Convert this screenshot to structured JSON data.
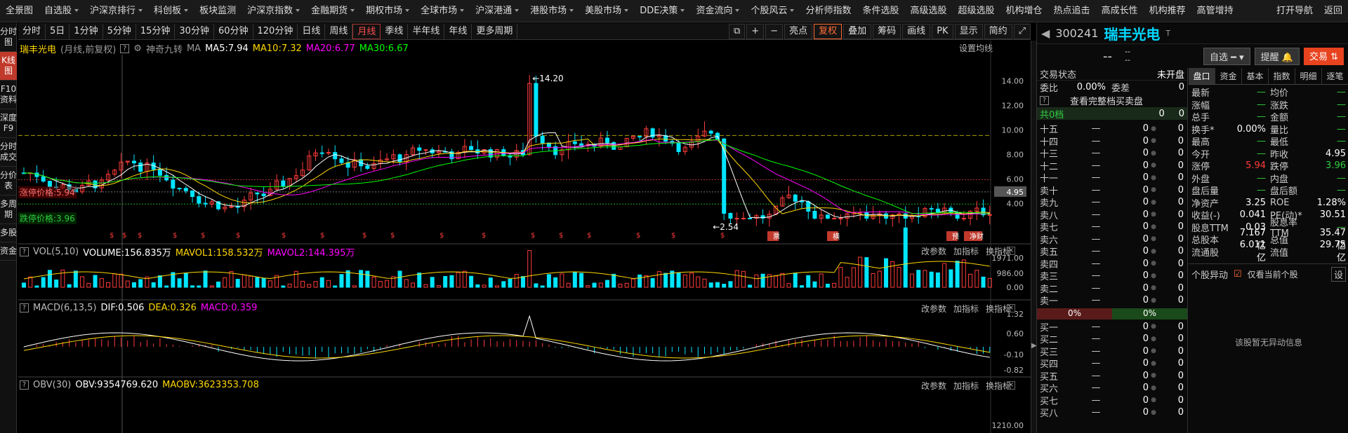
{
  "topnav": {
    "items": [
      "全景图",
      "自选股",
      "沪深京排行",
      "科创板",
      "板块监测",
      "沪深京指数",
      "金融期货",
      "期权市场",
      "全球市场",
      "沪深港通",
      "港股市场",
      "美股市场",
      "DDE决策",
      "资金流向",
      "个股风云",
      "分析师指数",
      "条件选股",
      "高级选股",
      "超级选股",
      "机构增仓",
      "热点追击",
      "高成长性",
      "机构推荐",
      "高管增持"
    ],
    "right": [
      "打开导航",
      "返回"
    ]
  },
  "leftbar": [
    "分时图",
    "K线图",
    "F10资料",
    "深度F9",
    "分时成交",
    "分价表",
    "多周期",
    "多股",
    "资金"
  ],
  "period": {
    "items": [
      "分时",
      "5日",
      "1分钟",
      "5分钟",
      "15分钟",
      "30分钟",
      "60分钟",
      "120分钟",
      "日线",
      "周线",
      "月线",
      "季线",
      "半年线",
      "年线",
      "更多周期"
    ],
    "active": "月线"
  },
  "tools": {
    "bright": "亮点",
    "restore": "复权",
    "overlay": "叠加",
    "chips": "筹码",
    "draw": "画线",
    "pk": "PK",
    "display": "显示",
    "simple": "简约"
  },
  "kpane": {
    "name": "瑞丰光电",
    "mode": "(月线,前复权)",
    "indicator": "神奇九转",
    "ma_label": "MA",
    "ma5": "MA5:7.94",
    "ma10": "MA10:7.32",
    "ma20": "MA20:6.77",
    "ma30": "MA30:6.67",
    "settings": "设置均线",
    "high_label": "14.20",
    "low_label": "2.54",
    "limit_up": "涨停价格:5.94",
    "limit_down": "跌停价格:3.96",
    "cur_price": "4.95",
    "yaxis": [
      "14.00",
      "12.00",
      "10.00",
      "8.00",
      "6.00",
      "4.00"
    ],
    "markers": [
      "票",
      "横",
      "预",
      "净财"
    ]
  },
  "vol": {
    "label": "VOL(5,10)",
    "volume": "VOLUME:156.835万",
    "mavol1": "MAVOL1:158.532万",
    "mavol2": "MAVOL2:144.395万",
    "yaxis": [
      "1971.00",
      "986.00",
      "0.00"
    ]
  },
  "macd": {
    "label": "MACD(6,13,5)",
    "dif": "DIF:0.506",
    "dea": "DEA:0.326",
    "macd": "MACD:0.359",
    "yaxis": [
      "1.32",
      "0.60",
      "-0.10",
      "-0.82"
    ]
  },
  "obv": {
    "label": "OBV(30)",
    "obv": "OBV:9354769.620",
    "maobv": "MAOBV:3623353.708",
    "yaxis": [
      "1210.00"
    ]
  },
  "pane_actions": [
    "改参数",
    "加指标",
    "换指标"
  ],
  "stock": {
    "code": "300241",
    "name": "瑞丰光电",
    "suffix": "T",
    "price": "--",
    "change": "--",
    "pct": "--",
    "self": "自选",
    "alert": "提醒",
    "trade": "交易"
  },
  "orderbook": {
    "status_label": "交易状态",
    "status": "未开盘",
    "weibi": "委比",
    "weibi_val": "0.00%",
    "weicha": "委差",
    "weicha_val": "0",
    "full_depth": "查看完整档买卖盘",
    "total": "共0档",
    "sell_labels": [
      "十五",
      "十四",
      "十三",
      "十二",
      "十一",
      "卖十",
      "卖九",
      "卖八",
      "卖七",
      "卖六",
      "卖五",
      "卖四",
      "卖三",
      "卖二",
      "卖一"
    ],
    "buy_labels": [
      "买一",
      "买二",
      "买三",
      "买四",
      "买五",
      "买六",
      "买七",
      "买八"
    ],
    "sell_pct": "0%",
    "buy_pct": "0%"
  },
  "quote": {
    "tabs": [
      "盘口",
      "资金",
      "基本",
      "指数",
      "明细",
      "逐笔"
    ],
    "rows": [
      [
        "最新",
        "—",
        "均价",
        "—"
      ],
      [
        "涨幅",
        "—",
        "涨跌",
        "—"
      ],
      [
        "总手",
        "—",
        "金额",
        "—"
      ],
      [
        "换手*",
        "0.00%",
        "量比",
        "—"
      ],
      [
        "最高",
        "—",
        "最低",
        "—"
      ],
      [
        "今开",
        "—",
        "昨收",
        "4.95"
      ],
      [
        "涨停",
        "5.94",
        "跌停",
        "3.96"
      ],
      [
        "外盘",
        "—",
        "内盘",
        "—"
      ],
      [
        "盘后量",
        "—",
        "盘后额",
        "—"
      ],
      [
        "净资产",
        "3.25",
        "ROE",
        "1.28%"
      ],
      [
        "收益(-)",
        "0.041",
        "PE(动)*",
        "30.51"
      ],
      [
        "股息TTM",
        "0.03",
        "股息率TTM",
        "—"
      ],
      [
        "总股本",
        "7.167亿",
        "总值",
        "35.47亿"
      ],
      [
        "流通股",
        "6.011亿",
        "流值",
        "29.75亿"
      ]
    ]
  },
  "abnormal": {
    "title": "个股异动",
    "check": "仅看当前个股",
    "setting": "设",
    "empty": "该股暂无异动信息"
  },
  "colors": {
    "up": "#ff3b3b",
    "down": "#00e5ff",
    "ma5": "#ffffff",
    "ma10": "#ffd700",
    "ma20": "#ff00ff",
    "ma30": "#00ff00"
  }
}
